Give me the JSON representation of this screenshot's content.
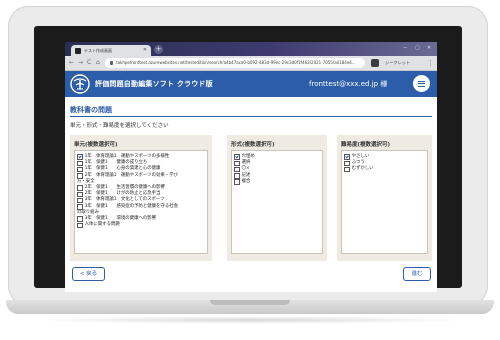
{
  "browser": {
    "tab_title": "テスト作成画面",
    "new_tab": "+",
    "win_minimize": "−",
    "win_maximize": "▢",
    "win_close": "✕",
    "tab_close": "✕",
    "back": "←",
    "forward": "→",
    "reload": "C",
    "home": "⌂",
    "url": "takhpefronttest.azurewebsites.net/testedition/search/a4b47aca0-b092-483d-99ec-29c3d0f1f463/2021-7055/a4184e4...",
    "profile": "シークレット",
    "more": "⋮"
  },
  "app": {
    "title": "評価問題自動編集ソフト クラウド版",
    "user": "fronttest@xxx.ed.jp 様",
    "brand_color": "#2b5da8"
  },
  "page": {
    "heading": "教科書の問題",
    "instruction": "単元・形式・難易度を選択してください"
  },
  "panels": {
    "unit": {
      "title": "単元(複数選択可)",
      "options": [
        {
          "label": "1年　体育理論1　運動やスポーツの多様性",
          "checked": true
        },
        {
          "label": "1年　保健1　　健康の成り立ち",
          "checked": false
        },
        {
          "label": "1年　保健1　　心身の発達と心の健康",
          "checked": false
        },
        {
          "label": "2年　体育理論1　運動やスポーツの効果・学び",
          "checked": false
        },
        {
          "label": "方・安全",
          "checked": null
        },
        {
          "label": "2年　保健1　　生活習慣の健康への影響",
          "checked": false
        },
        {
          "label": "2年　保健1　　けがの防止と応急手当",
          "checked": false
        },
        {
          "label": "3年　体育理論1　文化としてのスポーツ",
          "checked": false
        },
        {
          "label": "3年　保健1　　感染症の予防と健康を守る社会",
          "checked": false
        },
        {
          "label": "の取り組み",
          "checked": null
        },
        {
          "label": "3年　保健1　　環境の健康への影響",
          "checked": false
        },
        {
          "label": "人体に関する問題",
          "checked": false
        }
      ]
    },
    "format": {
      "title": "形式(複数選択可)",
      "options": [
        {
          "label": "穴埋め",
          "checked": true
        },
        {
          "label": "選択",
          "checked": false
        },
        {
          "label": "〇×",
          "checked": false
        },
        {
          "label": "記述",
          "checked": false
        },
        {
          "label": "複合",
          "checked": false
        }
      ]
    },
    "difficulty": {
      "title": "難易度(複数選択可)",
      "options": [
        {
          "label": "やさしい",
          "checked": true
        },
        {
          "label": "ふつう",
          "checked": false
        },
        {
          "label": "むずかしい",
          "checked": false
        }
      ]
    }
  },
  "footer": {
    "back_label": "< 戻る",
    "next_label": "進む"
  }
}
